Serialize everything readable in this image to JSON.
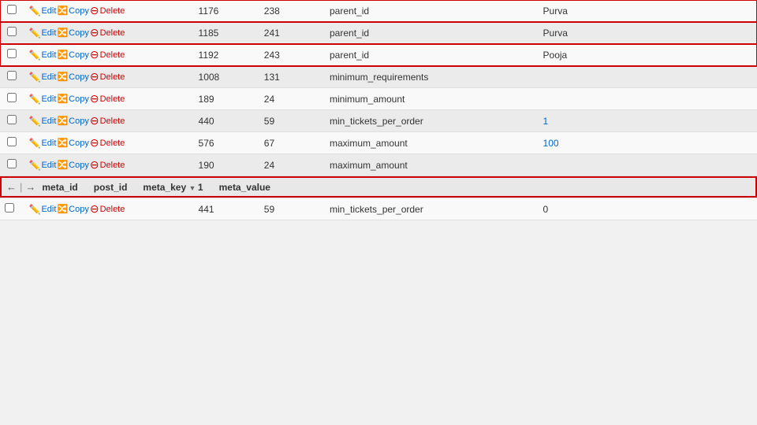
{
  "table": {
    "columns": [
      {
        "id": "checkbox",
        "label": ""
      },
      {
        "id": "actions",
        "label": ""
      },
      {
        "id": "meta_id",
        "label": "meta_id"
      },
      {
        "id": "post_id",
        "label": "post_id"
      },
      {
        "id": "meta_key",
        "label": "meta_key",
        "sortable": true,
        "sort_indicator": "▼"
      },
      {
        "id": "meta_value",
        "label": "meta_value"
      }
    ],
    "rows": [
      {
        "id": 1,
        "meta_id": "1176",
        "post_id": "238",
        "meta_key": "parent_id",
        "meta_value": "Purva",
        "highlighted": true,
        "value_color": "normal"
      },
      {
        "id": 2,
        "meta_id": "1185",
        "post_id": "241",
        "meta_key": "parent_id",
        "meta_value": "Purva",
        "highlighted": true,
        "value_color": "normal"
      },
      {
        "id": 3,
        "meta_id": "1192",
        "post_id": "243",
        "meta_key": "parent_id",
        "meta_value": "Pooja",
        "highlighted": true,
        "value_color": "normal"
      },
      {
        "id": 4,
        "meta_id": "1008",
        "post_id": "131",
        "meta_key": "minimum_requirements",
        "meta_value": "",
        "highlighted": false,
        "value_color": "normal"
      },
      {
        "id": 5,
        "meta_id": "189",
        "post_id": "24",
        "meta_key": "minimum_amount",
        "meta_value": "",
        "highlighted": false,
        "value_color": "normal"
      },
      {
        "id": 6,
        "meta_id": "440",
        "post_id": "59",
        "meta_key": "min_tickets_per_order",
        "meta_value": "1",
        "highlighted": false,
        "value_color": "blue"
      },
      {
        "id": 7,
        "meta_id": "576",
        "post_id": "67",
        "meta_key": "maximum_amount",
        "meta_value": "100",
        "highlighted": false,
        "value_color": "blue"
      },
      {
        "id": 8,
        "meta_id": "190",
        "post_id": "24",
        "meta_key": "maximum_amount",
        "meta_value": "",
        "highlighted": false,
        "value_color": "normal"
      }
    ],
    "actions": {
      "edit_label": "Edit",
      "copy_label": "Copy",
      "delete_label": "Delete"
    },
    "nav": {
      "prev_label": "←",
      "separator": "|",
      "next_label": "→",
      "sort_value": "1"
    },
    "footer_row_partial": {
      "meta_id": "441",
      "post_id": "59",
      "meta_key": "min_tickets_per_order",
      "meta_value": "0"
    }
  }
}
